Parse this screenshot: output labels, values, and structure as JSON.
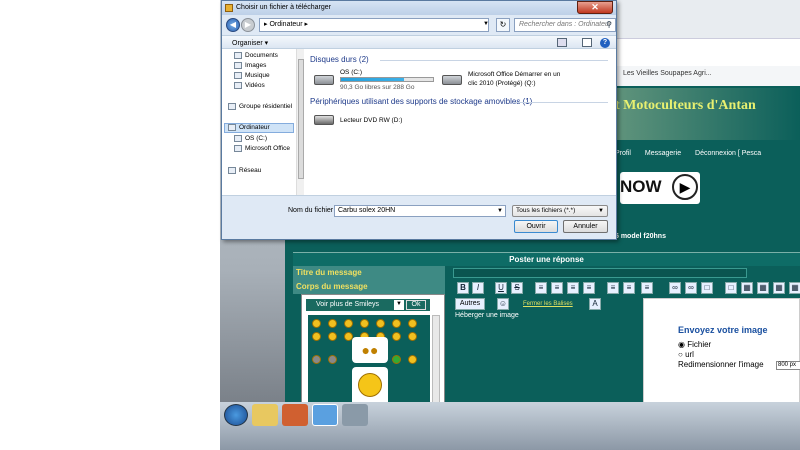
{
  "dialog": {
    "title": "Choisir un fichier à télécharger",
    "address": "▸ Ordinateur ▸",
    "search_placeholder": "Rechercher dans : Ordinateur",
    "organiser_label": "Organiser ▾",
    "tree": [
      {
        "label": "Documents"
      },
      {
        "label": "Images"
      },
      {
        "label": "Musique"
      },
      {
        "label": "Vidéos"
      },
      {
        "label": "Groupe résidentiel"
      },
      {
        "label": "Ordinateur"
      },
      {
        "label": "OS (C:)"
      },
      {
        "label": "Microsoft Office"
      },
      {
        "label": "Réseau"
      }
    ],
    "groups": {
      "hard_disks": "Disques durs (2)",
      "removable": "Périphériques utilisant des supports de stockage amovibles (1)"
    },
    "drives": {
      "c_name": "OS (C:)",
      "c_free": "90,3 Go libres sur 288 Go",
      "c_used_fraction": 0.69,
      "q_name_line1": "Microsoft Office Démarrer en un",
      "q_name_line2": "clic 2010 (Protégé) (Q:)",
      "dvd_name": "Lecteur DVD RW (D:)"
    },
    "filename_label": "Nom du fichier :",
    "filename_value": "Carbu solex 20HN",
    "filetype_value": "Tous les fichiers (*.*)",
    "open_button": "Ouvrir",
    "cancel_button": "Annuler"
  },
  "browser": {
    "favorite_text": "Les Vieilles Soupapes Agri..."
  },
  "site": {
    "title": "t Motoculteurs d'Antan",
    "nav_items": [
      "Profil",
      "Messagerie",
      "Déconnexion [ Pesca"
    ],
    "now_button": "NOW",
    "model_text": "6 model f20hns",
    "post_header": "Poster une réponse",
    "label_title": "Titre du message",
    "label_body": "Corps du message",
    "smileys_button": "Voir plus de Smileys",
    "smileys_ok": "Ok",
    "autres_button": "Autres",
    "fermer_link": "Fermer les Balises",
    "heberger_text": "Héberger une image",
    "upload": {
      "title": "Envoyez votre image",
      "radio_fichier": "Fichier",
      "radio_url": "url",
      "resize_label": "Redimensionner l'image",
      "resize_value": "800 px"
    }
  }
}
